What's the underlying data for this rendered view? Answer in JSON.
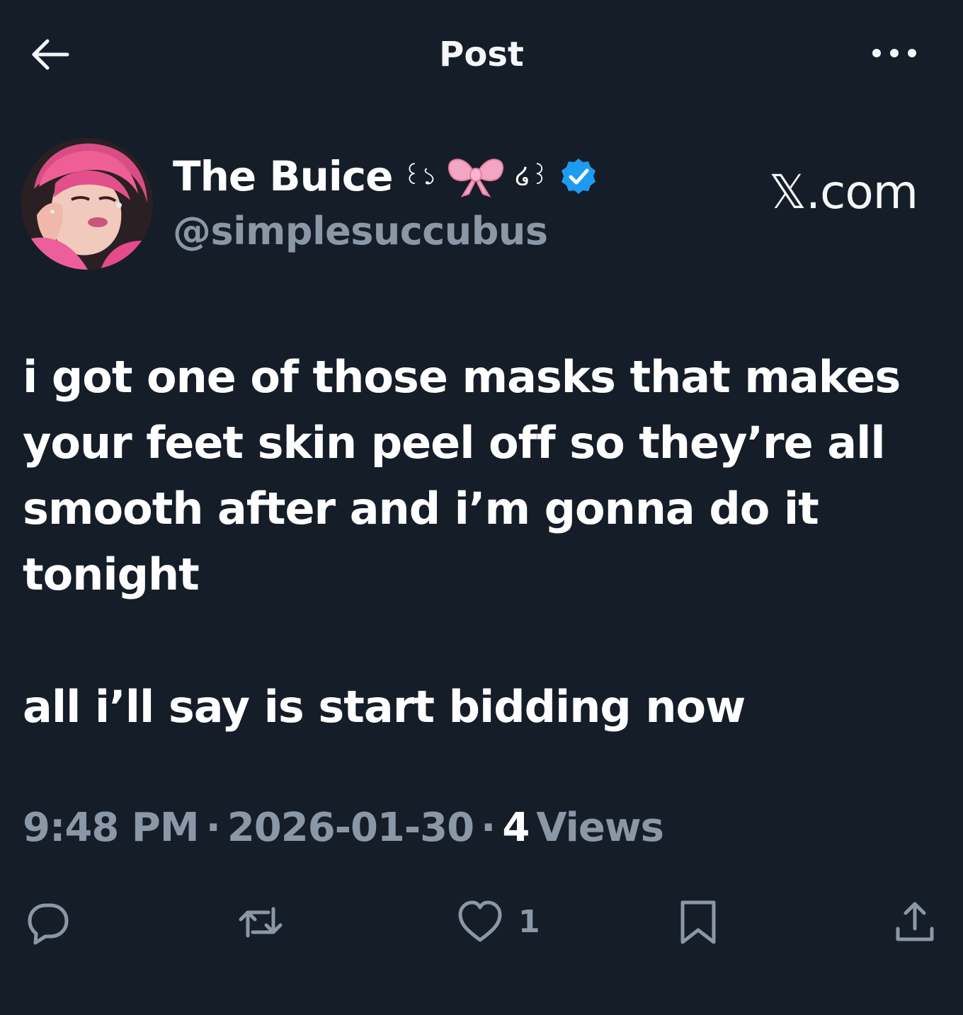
{
  "header": {
    "title": "Post"
  },
  "author": {
    "display_name": "The Buice",
    "name_decoration_left": "꒰১",
    "name_decoration_right": "໒꒱",
    "username": "@simplesuccubus",
    "verified": true
  },
  "source_label": "𝕏.com",
  "post": {
    "paragraphs": [
      "i got one of those masks that makes your feet skin peel off so they’re all smooth after and i’m gonna do it tonight",
      "all i’ll say is start bidding now"
    ]
  },
  "meta": {
    "time": "9:48 PM",
    "separator": "·",
    "date": "2026-01-30",
    "views_count": "4",
    "views_label": "Views"
  },
  "actions": {
    "reply_count": "",
    "repost_count": "",
    "like_count": "1"
  },
  "colors": {
    "background": "#151d28",
    "text_primary": "#ffffff",
    "text_secondary": "#8a97a6",
    "verified_blue": "#1d9bf0",
    "bow_pink": "#f3a6c2"
  },
  "icons": {
    "back": "arrow-left-icon",
    "more": "more-dots-icon",
    "verified": "verified-badge-icon",
    "bow": "ribbon-bow-icon",
    "reply": "reply-icon",
    "repost": "repost-icon",
    "like": "heart-icon",
    "bookmark": "bookmark-icon",
    "share": "share-icon"
  }
}
